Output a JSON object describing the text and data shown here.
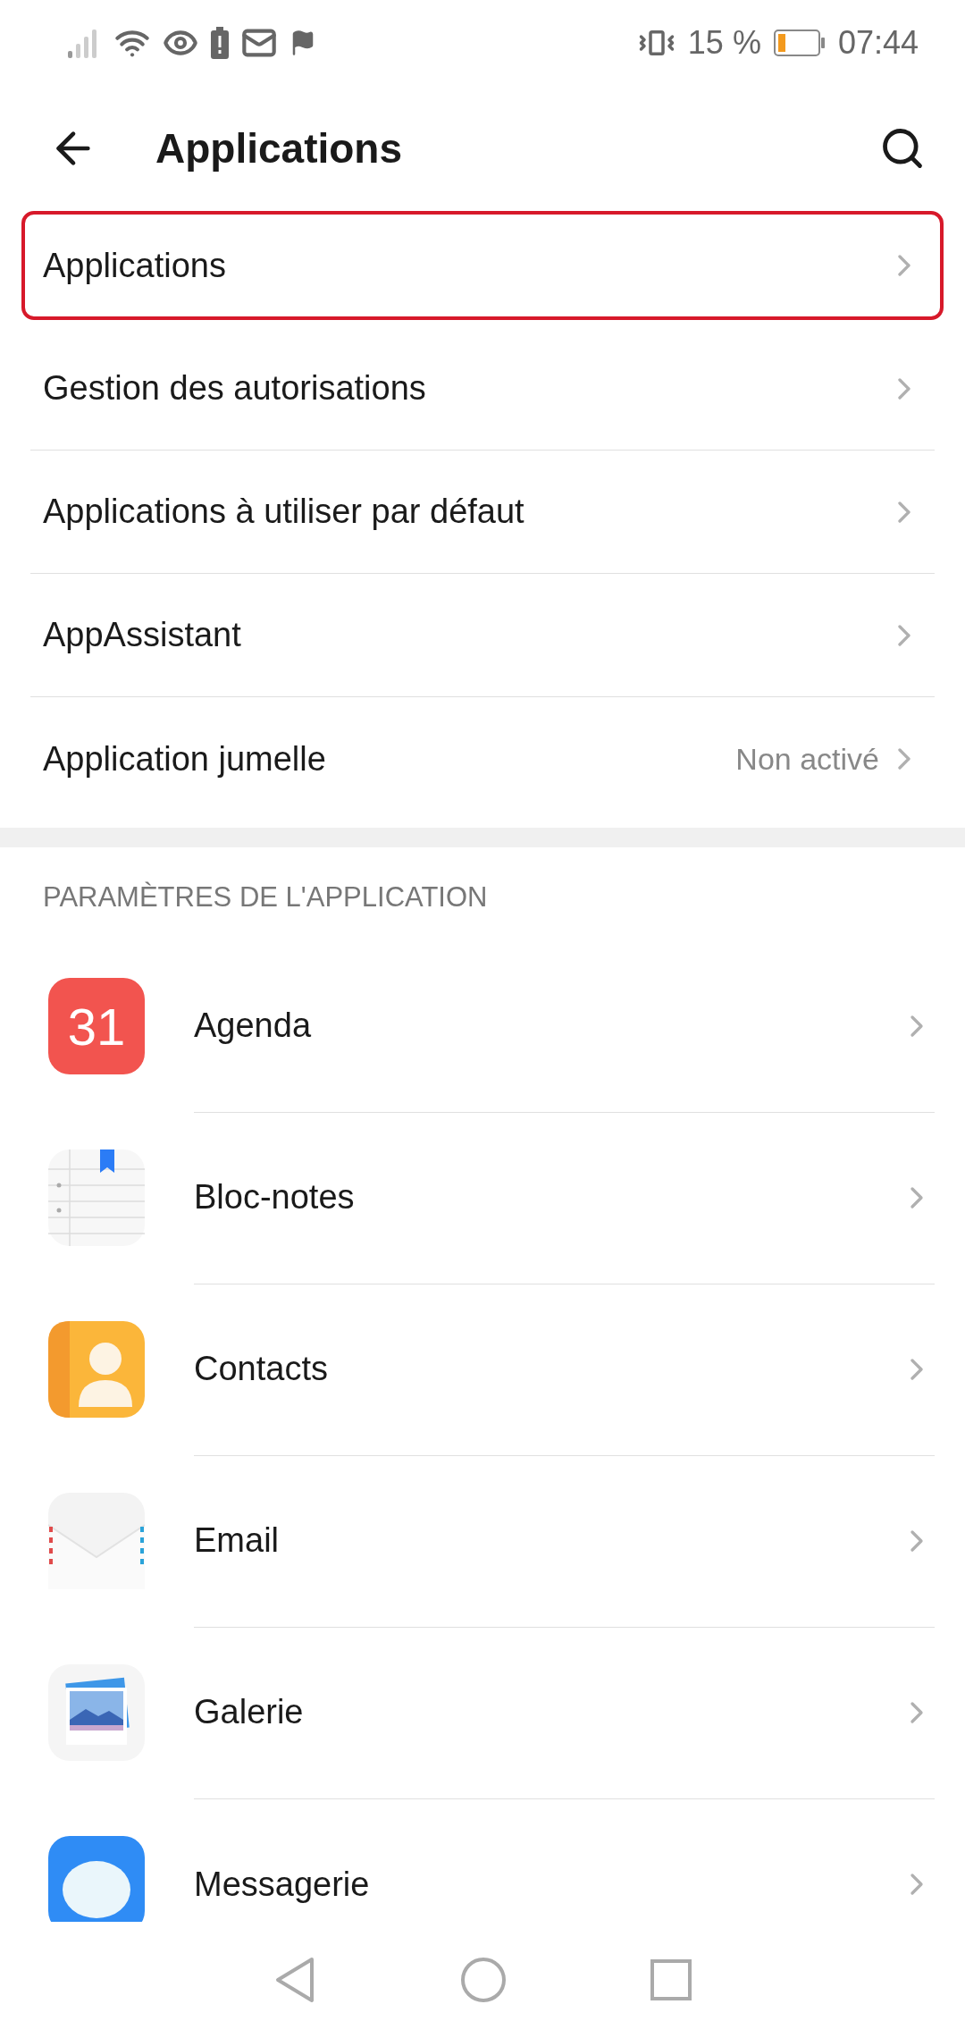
{
  "status_bar": {
    "battery_text": "15 %",
    "time": "07:44"
  },
  "app_bar": {
    "title": "Applications"
  },
  "menu": [
    {
      "label": "Applications",
      "highlighted": true
    },
    {
      "label": "Gestion des autorisations",
      "highlighted": false
    },
    {
      "label": "Applications à utiliser par défaut",
      "highlighted": false
    },
    {
      "label": "AppAssistant",
      "highlighted": false
    },
    {
      "label": "Application jumelle",
      "highlighted": false,
      "value": "Non activé"
    }
  ],
  "section": {
    "header": "PARAMÈTRES DE L'APPLICATION",
    "apps": [
      {
        "label": "Agenda",
        "kind": "calendar",
        "icon_text": "31"
      },
      {
        "label": "Bloc-notes",
        "kind": "notes"
      },
      {
        "label": "Contacts",
        "kind": "contacts"
      },
      {
        "label": "Email",
        "kind": "email"
      },
      {
        "label": "Galerie",
        "kind": "gallery"
      },
      {
        "label": "Messagerie",
        "kind": "messages"
      }
    ]
  }
}
